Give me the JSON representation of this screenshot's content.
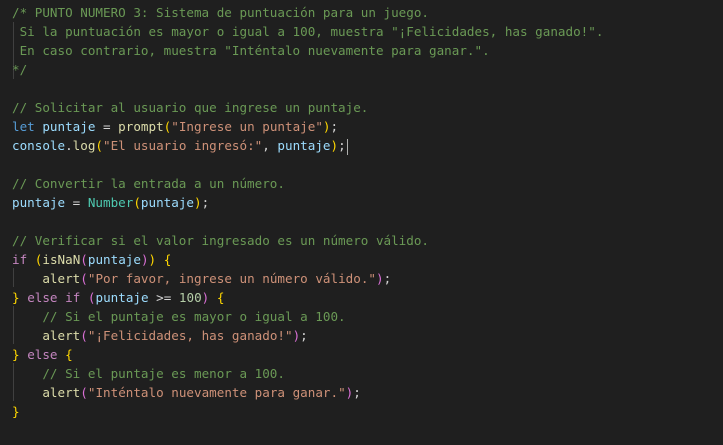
{
  "theme": {
    "background": "#1f1f1f",
    "comment": "#6a9955",
    "keyword": "#569cd6",
    "control": "#c586c0",
    "variable": "#9cdcfe",
    "function": "#dcdcaa",
    "string": "#ce9178",
    "number": "#b5cea8",
    "type": "#4ec9b0",
    "punct": "#d4d4d4",
    "bracket1": "#ffd700",
    "bracket2": "#da70d6",
    "bracket3": "#179fff"
  },
  "editor": {
    "lines": [
      {
        "tokens": [
          {
            "t": "/* PUNTO NUMERO 3: Sistema de puntuación para un juego.",
            "c": "comment"
          }
        ]
      },
      {
        "tokens": [
          {
            "t": " Si la puntuación es mayor o igual a 100, muestra \"¡Felicidades, has ganado!\".",
            "c": "comment"
          }
        ]
      },
      {
        "tokens": [
          {
            "t": " En caso contrario, muestra \"Inténtalo nuevamente para ganar.\".",
            "c": "comment"
          }
        ]
      },
      {
        "tokens": [
          {
            "t": "*/",
            "c": "comment"
          }
        ]
      },
      {
        "tokens": []
      },
      {
        "tokens": [
          {
            "t": "// Solicitar al usuario que ingrese un puntaje.",
            "c": "comment"
          }
        ]
      },
      {
        "tokens": [
          {
            "t": "let",
            "c": "keyword"
          },
          {
            "t": " ",
            "c": "punct"
          },
          {
            "t": "puntaje",
            "c": "variable"
          },
          {
            "t": " = ",
            "c": "punct"
          },
          {
            "t": "prompt",
            "c": "function"
          },
          {
            "t": "(",
            "c": "bracket1"
          },
          {
            "t": "\"Ingrese un puntaje\"",
            "c": "string"
          },
          {
            "t": ")",
            "c": "bracket1"
          },
          {
            "t": ";",
            "c": "punct"
          }
        ]
      },
      {
        "tokens": [
          {
            "t": "console",
            "c": "variable"
          },
          {
            "t": ".",
            "c": "punct"
          },
          {
            "t": "log",
            "c": "function"
          },
          {
            "t": "(",
            "c": "bracket1"
          },
          {
            "t": "\"El usuario ingresó:\"",
            "c": "string"
          },
          {
            "t": ", ",
            "c": "punct"
          },
          {
            "t": "puntaje",
            "c": "variable"
          },
          {
            "t": ")",
            "c": "bracket1"
          },
          {
            "t": ";",
            "c": "punct"
          }
        ],
        "cursor": true
      },
      {
        "tokens": []
      },
      {
        "tokens": [
          {
            "t": "// Convertir la entrada a un número.",
            "c": "comment"
          }
        ]
      },
      {
        "tokens": [
          {
            "t": "puntaje",
            "c": "variable"
          },
          {
            "t": " = ",
            "c": "punct"
          },
          {
            "t": "Number",
            "c": "type"
          },
          {
            "t": "(",
            "c": "bracket1"
          },
          {
            "t": "puntaje",
            "c": "variable"
          },
          {
            "t": ")",
            "c": "bracket1"
          },
          {
            "t": ";",
            "c": "punct"
          }
        ]
      },
      {
        "tokens": []
      },
      {
        "tokens": [
          {
            "t": "// Verificar si el valor ingresado es un número válido.",
            "c": "comment"
          }
        ]
      },
      {
        "tokens": [
          {
            "t": "if",
            "c": "control"
          },
          {
            "t": " ",
            "c": "punct"
          },
          {
            "t": "(",
            "c": "bracket1"
          },
          {
            "t": "isNaN",
            "c": "function"
          },
          {
            "t": "(",
            "c": "bracket2"
          },
          {
            "t": "puntaje",
            "c": "variable"
          },
          {
            "t": ")",
            "c": "bracket2"
          },
          {
            "t": ")",
            "c": "bracket1"
          },
          {
            "t": " ",
            "c": "punct"
          },
          {
            "t": "{",
            "c": "bracket1"
          }
        ]
      },
      {
        "tokens": [
          {
            "t": "    ",
            "c": "punct"
          },
          {
            "t": "alert",
            "c": "function"
          },
          {
            "t": "(",
            "c": "bracket2"
          },
          {
            "t": "\"Por favor, ingrese un número válido.\"",
            "c": "string"
          },
          {
            "t": ")",
            "c": "bracket2"
          },
          {
            "t": ";",
            "c": "punct"
          }
        ]
      },
      {
        "tokens": [
          {
            "t": "}",
            "c": "bracket1"
          },
          {
            "t": " ",
            "c": "punct"
          },
          {
            "t": "else",
            "c": "control"
          },
          {
            "t": " ",
            "c": "punct"
          },
          {
            "t": "if",
            "c": "control"
          },
          {
            "t": " ",
            "c": "punct"
          },
          {
            "t": "(",
            "c": "bracket2"
          },
          {
            "t": "puntaje",
            "c": "variable"
          },
          {
            "t": " >= ",
            "c": "punct"
          },
          {
            "t": "100",
            "c": "number"
          },
          {
            "t": ")",
            "c": "bracket2"
          },
          {
            "t": " ",
            "c": "punct"
          },
          {
            "t": "{",
            "c": "bracket1"
          }
        ]
      },
      {
        "tokens": [
          {
            "t": "    ",
            "c": "punct"
          },
          {
            "t": "// Si el puntaje es mayor o igual a 100.",
            "c": "comment"
          }
        ]
      },
      {
        "tokens": [
          {
            "t": "    ",
            "c": "punct"
          },
          {
            "t": "alert",
            "c": "function"
          },
          {
            "t": "(",
            "c": "bracket2"
          },
          {
            "t": "\"¡Felicidades, has ganado!\"",
            "c": "string"
          },
          {
            "t": ")",
            "c": "bracket2"
          },
          {
            "t": ";",
            "c": "punct"
          }
        ]
      },
      {
        "tokens": [
          {
            "t": "}",
            "c": "bracket1"
          },
          {
            "t": " ",
            "c": "punct"
          },
          {
            "t": "else",
            "c": "control"
          },
          {
            "t": " ",
            "c": "punct"
          },
          {
            "t": "{",
            "c": "bracket1"
          }
        ]
      },
      {
        "tokens": [
          {
            "t": "    ",
            "c": "punct"
          },
          {
            "t": "// Si el puntaje es menor a 100.",
            "c": "comment"
          }
        ]
      },
      {
        "tokens": [
          {
            "t": "    ",
            "c": "punct"
          },
          {
            "t": "alert",
            "c": "function"
          },
          {
            "t": "(",
            "c": "bracket2"
          },
          {
            "t": "\"Inténtalo nuevamente para ganar.\"",
            "c": "string"
          },
          {
            "t": ")",
            "c": "bracket2"
          },
          {
            "t": ";",
            "c": "punct"
          }
        ]
      },
      {
        "tokens": [
          {
            "t": "}",
            "c": "bracket1"
          }
        ]
      }
    ]
  }
}
